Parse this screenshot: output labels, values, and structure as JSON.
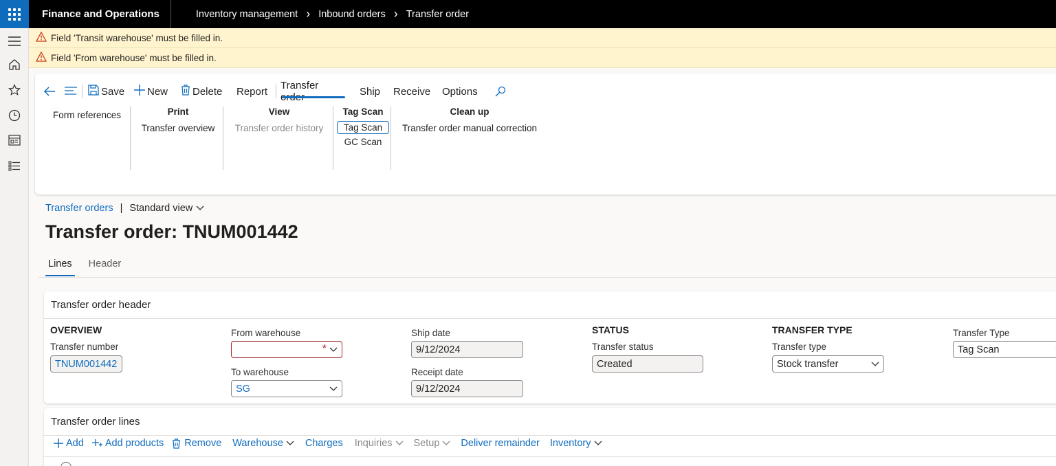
{
  "topbar": {
    "app_title": "Finance and Operations",
    "breadcrumbs": [
      "Inventory management",
      "Inbound orders",
      "Transfer order"
    ]
  },
  "banners": [
    "Field 'Transit warehouse' must be filled in.",
    "Field 'From warehouse' must be filled in."
  ],
  "actionpane": {
    "save": "Save",
    "new": "New",
    "delete": "Delete",
    "report": "Report",
    "tabs": [
      "Transfer order",
      "Ship",
      "Receive",
      "Options"
    ],
    "form_references": "Form references",
    "groups": {
      "print": {
        "title": "Print",
        "items": [
          "Transfer overview"
        ]
      },
      "view": {
        "title": "View",
        "items": [
          "Transfer order history"
        ]
      },
      "tagscan": {
        "title": "Tag Scan",
        "items": [
          "Tag Scan",
          "GC Scan"
        ]
      },
      "cleanup": {
        "title": "Clean up",
        "items": [
          "Transfer order manual correction"
        ]
      }
    }
  },
  "page": {
    "list_link": "Transfer orders",
    "view_name": "Standard view",
    "title": "Transfer order: TNUM001442",
    "tabs": [
      "Lines",
      "Header"
    ]
  },
  "header_card": {
    "title": "Transfer order header",
    "overview": {
      "title": "OVERVIEW",
      "transfer_number_label": "Transfer number",
      "transfer_number": "TNUM001442"
    },
    "warehouses": {
      "from_label": "From warehouse",
      "from_value": "",
      "to_label": "To warehouse",
      "to_value": "SG"
    },
    "dates": {
      "ship_label": "Ship date",
      "ship_value": "9/12/2024",
      "receipt_label": "Receipt date",
      "receipt_value": "9/12/2024"
    },
    "status": {
      "title": "STATUS",
      "label": "Transfer status",
      "value": "Created"
    },
    "transfer_type": {
      "title": "TRANSFER TYPE",
      "label": "Transfer type",
      "value": "Stock transfer"
    },
    "tag_type": {
      "label": "Transfer Type",
      "value": "Tag Scan"
    }
  },
  "lines_card": {
    "title": "Transfer order lines",
    "toolbar": {
      "add": "Add",
      "add_products": "Add products",
      "remove": "Remove",
      "warehouse": "Warehouse",
      "charges": "Charges",
      "inquiries": "Inquiries",
      "setup": "Setup",
      "deliver_remainder": "Deliver remainder",
      "inventory": "Inventory"
    }
  },
  "colors": {
    "accent": "#0f6cbd",
    "warning_bg": "#fff4ce",
    "error": "#a4262c"
  }
}
